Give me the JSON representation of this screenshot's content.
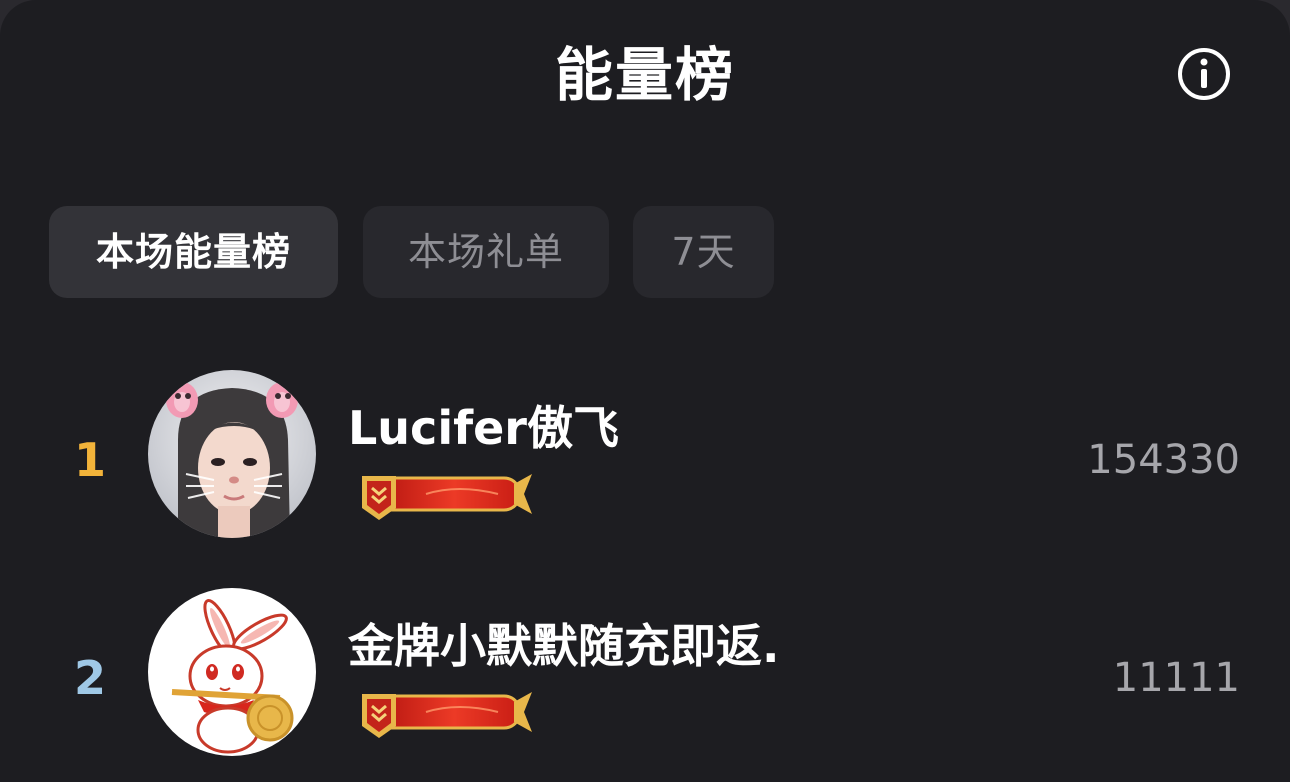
{
  "header": {
    "title": "能量榜",
    "info_icon": "info-icon"
  },
  "tabs": [
    {
      "label": "本场能量榜",
      "active": true
    },
    {
      "label": "本场礼单",
      "active": false
    },
    {
      "label": "7天",
      "active": false
    }
  ],
  "ranking": [
    {
      "rank": "1",
      "rank_color": "#f2b33a",
      "name": "Lucifer傲飞",
      "score": "154330",
      "avatar": "avatar-photo",
      "badge": "level-badge"
    },
    {
      "rank": "2",
      "rank_color": "#9fc8e6",
      "name": "金牌小默默随充即返.",
      "score": "11111",
      "avatar": "avatar-rabbit",
      "badge": "level-badge"
    }
  ],
  "colors": {
    "background": "#1d1d21",
    "tab_active": "#333338",
    "tab_inactive": "#28282d",
    "badge_red": "#d8261c",
    "badge_gold": "#e8b74a"
  }
}
